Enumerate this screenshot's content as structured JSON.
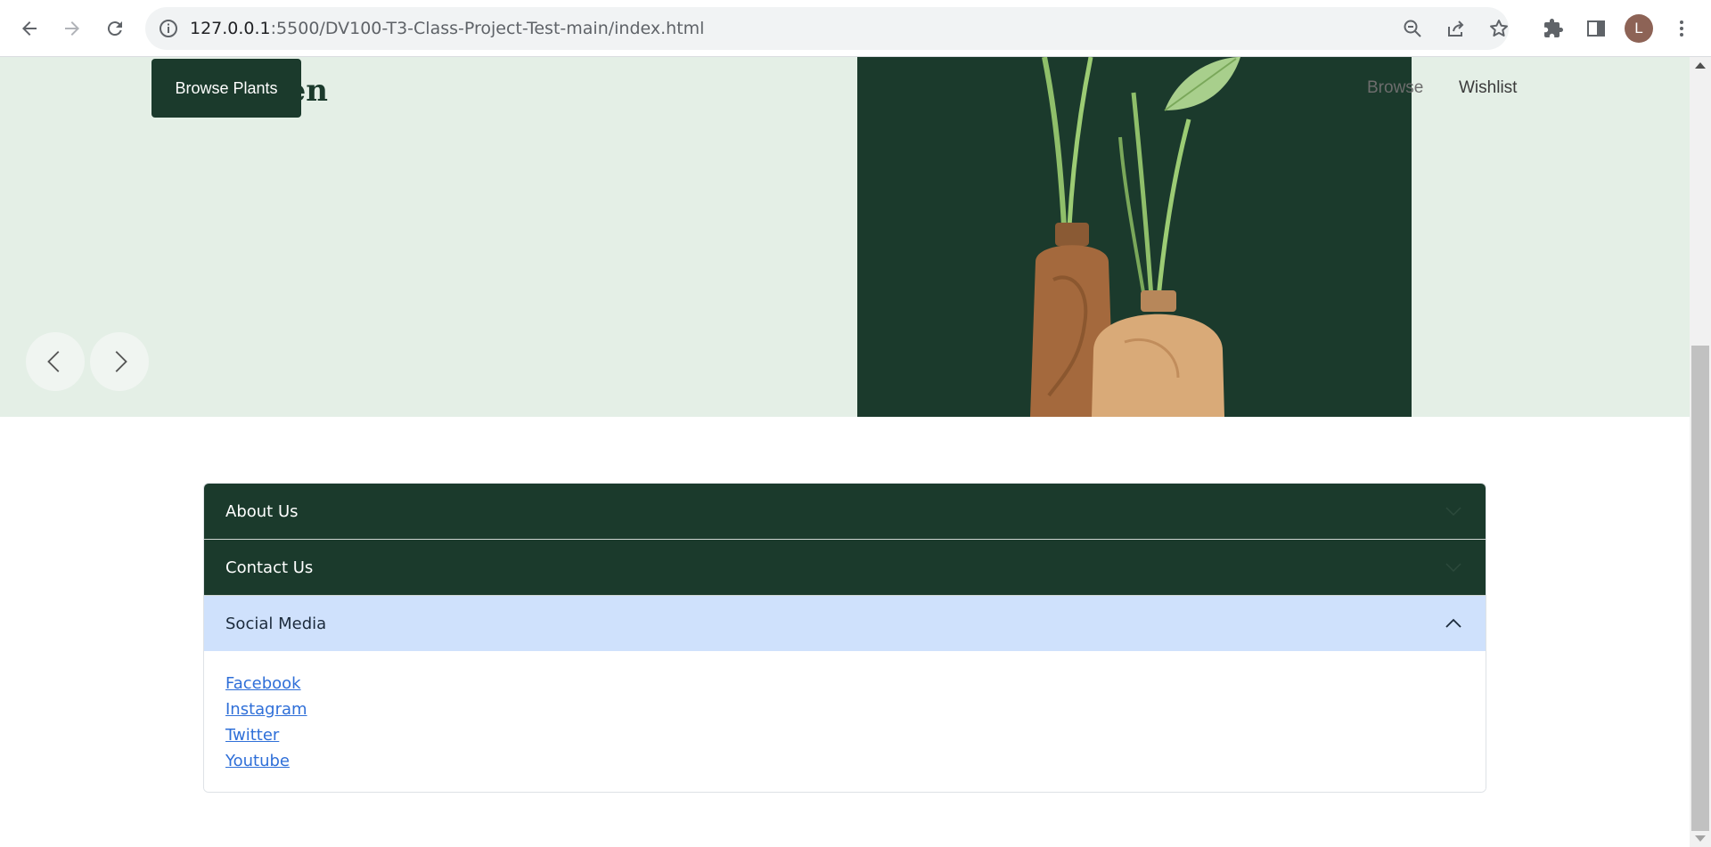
{
  "browser": {
    "url_host": "127.0.0.1",
    "url_path": ":5500/DV100-T3-Class-Project-Test-main/index.html",
    "profile_initial": "L",
    "icons": [
      "back-icon",
      "forward-icon",
      "reload-icon",
      "info-icon",
      "zoom-out-icon",
      "share-icon",
      "star-icon",
      "extensions-icon",
      "side-panel-icon",
      "kebab-menu-icon"
    ]
  },
  "hero": {
    "brand_visible_fragment": "een",
    "browse_button_label": "Browse Plants",
    "nav": {
      "browse": "Browse",
      "wishlist": "Wishlist"
    },
    "prev_icon": "chevron-left-icon",
    "next_icon": "chevron-right-icon"
  },
  "accordion": {
    "items": [
      {
        "label": "About Us",
        "expanded": false
      },
      {
        "label": "Contact Us",
        "expanded": false
      },
      {
        "label": "Social Media",
        "expanded": true
      }
    ],
    "social_links": [
      "Facebook",
      "Instagram",
      "Twitter",
      "Youtube"
    ]
  },
  "colors": {
    "dark_green": "#1b3a2c",
    "hero_bg": "#e4efe6",
    "accordion_open_bg": "#cfe1fc",
    "link": "#2f6fd8"
  }
}
